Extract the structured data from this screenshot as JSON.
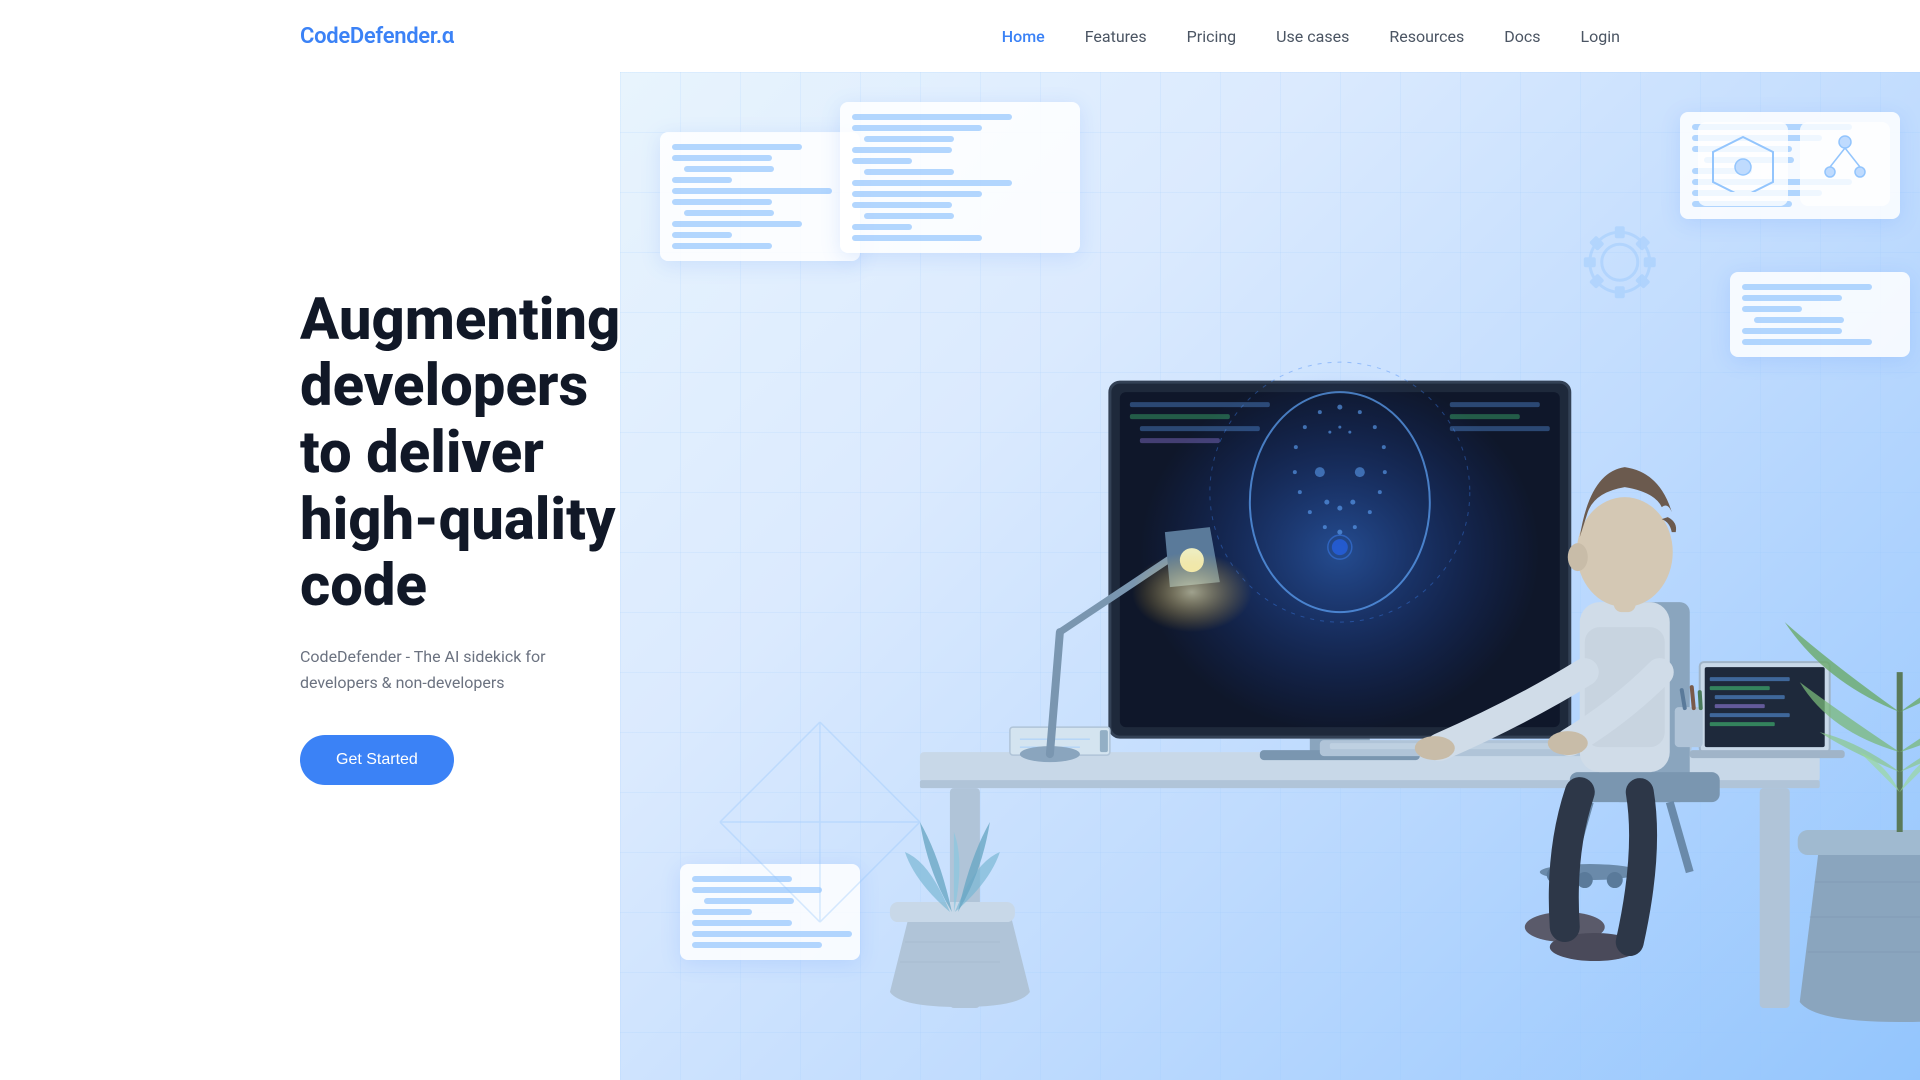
{
  "brand": {
    "name": "CodeDefender",
    "suffix": ".α"
  },
  "nav": {
    "links": [
      {
        "label": "Home",
        "active": true
      },
      {
        "label": "Features",
        "active": false
      },
      {
        "label": "Pricing",
        "active": false
      },
      {
        "label": "Use cases",
        "active": false
      },
      {
        "label": "Resources",
        "active": false
      },
      {
        "label": "Docs",
        "active": false
      },
      {
        "label": "Login",
        "active": false
      }
    ]
  },
  "hero": {
    "title": "Augmenting developers to deliver high-quality code",
    "subtitle": "CodeDefender - The AI sidekick for developers & non-developers",
    "cta_label": "Get Started"
  },
  "colors": {
    "accent": "#3b82f6",
    "text_primary": "#111827",
    "text_secondary": "#6b7280",
    "nav_active": "#3b82f6",
    "nav_default": "#4b5563"
  }
}
